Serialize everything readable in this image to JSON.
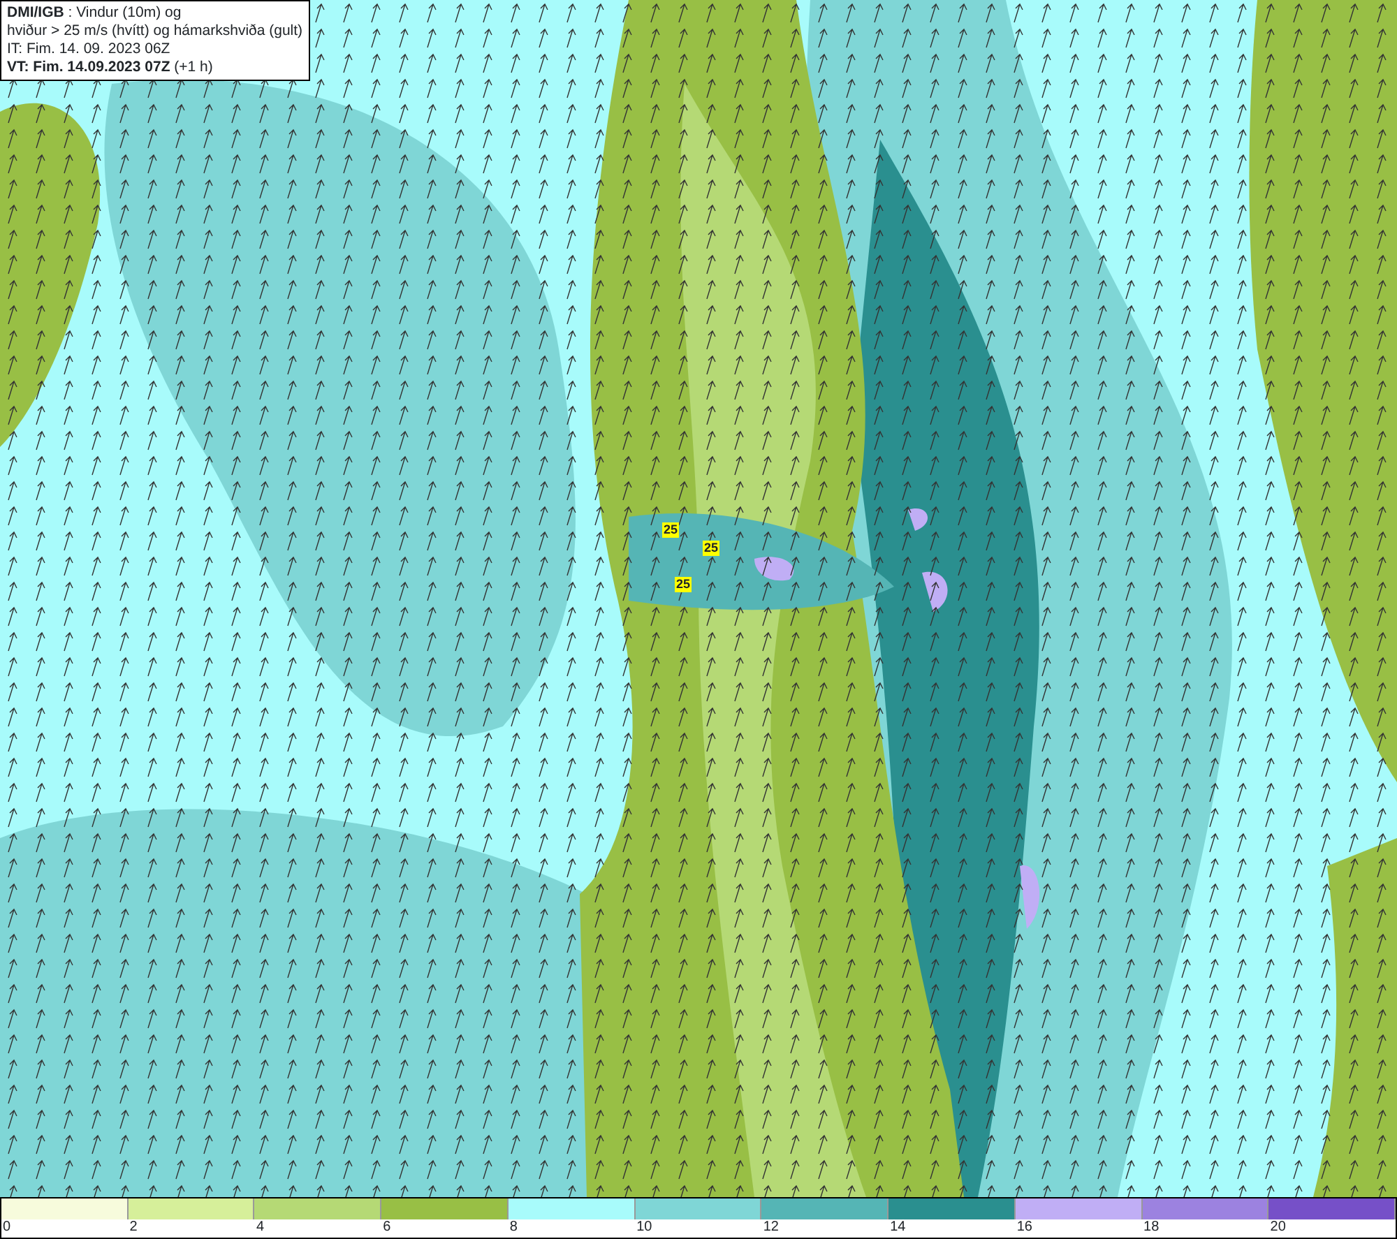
{
  "header": {
    "lines": [
      "**DMI/IGB** : Vindur (10m) og",
      "hviður > 25 m/s (hvítt) og hámarkshviða (gult)",
      "IT: Fim. 14. 09. 2023 06Z",
      "**VT: Fim. 14.09.2023 07Z** (+1 h)"
    ]
  },
  "map": {
    "gust_labels": [
      "25",
      "25",
      "25"
    ]
  },
  "legend": {
    "swatches": [
      {
        "color": "#f7fbdc"
      },
      {
        "color": "#d6ef9a"
      },
      {
        "color": "#b5d975"
      },
      {
        "color": "#98bf45"
      },
      {
        "color": "#a8fbfb"
      },
      {
        "color": "#7fd6d6"
      },
      {
        "color": "#55b5b5"
      },
      {
        "color": "#2a8f8f"
      },
      {
        "color": "#c0aef5"
      },
      {
        "color": "#9c82e0"
      },
      {
        "color": "#7650c8"
      }
    ],
    "labels": [
      "0",
      "2",
      "4",
      "6",
      "8",
      "10",
      "12",
      "14",
      "16",
      "18",
      "20"
    ]
  }
}
